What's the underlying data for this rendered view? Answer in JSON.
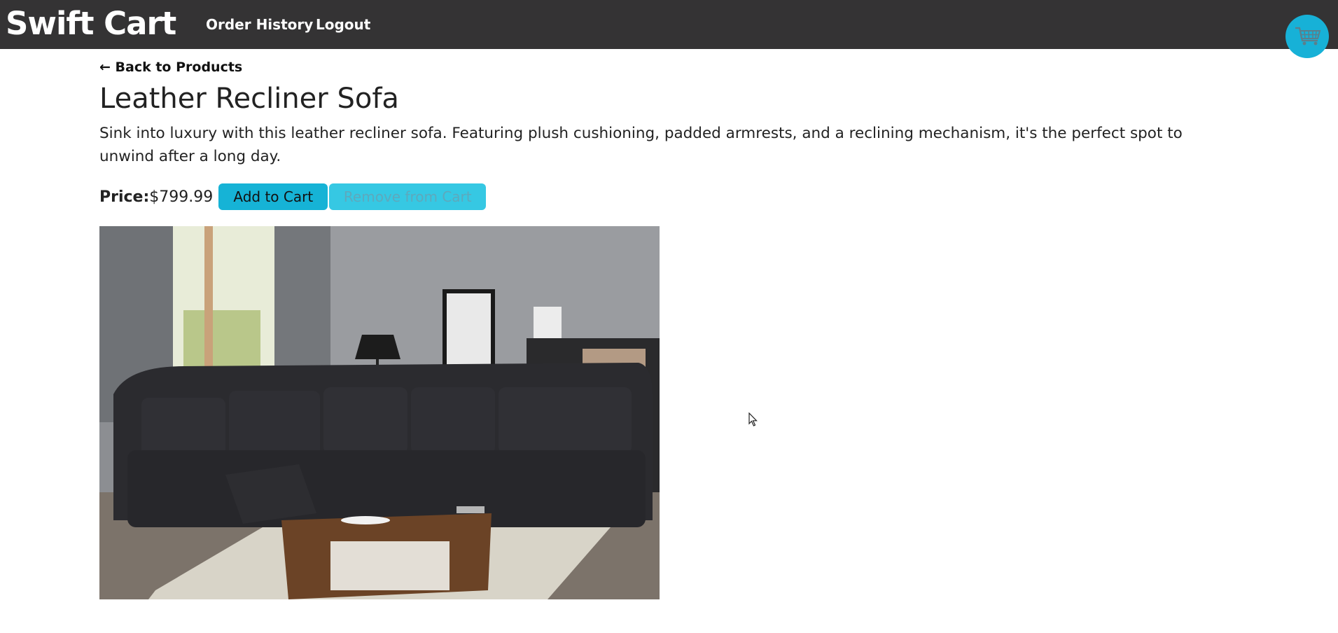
{
  "navbar": {
    "brand": "Swift Cart",
    "links": [
      "Order History",
      "Logout"
    ],
    "cart_icon": "shopping-cart-icon",
    "background": "#343334",
    "cart_color": "#17b1d7"
  },
  "product": {
    "back_link": "← Back to Products",
    "title": "Leather Recliner Sofa",
    "description": "Sink into luxury with this leather recliner sofa. Featuring plush cushioning, padded armrests, and a reclining mechanism, it's the perfect spot to unwind after a long day.",
    "price_label": "Price:",
    "price_value": "$799.99",
    "add_button": "Add to Cart",
    "remove_button": "Remove from Cart",
    "image_alt": "product-photo-sofa"
  },
  "colors": {
    "accent": "#16b3d6",
    "accent_light": "#36c8e3"
  }
}
